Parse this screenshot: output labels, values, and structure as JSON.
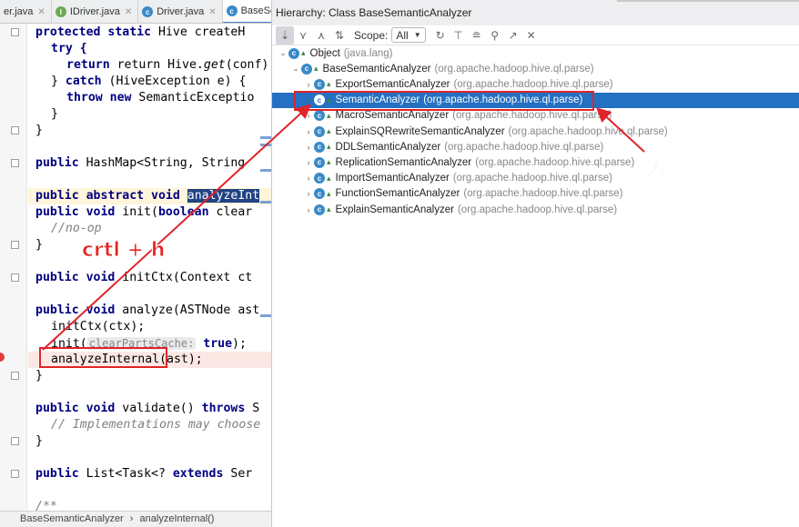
{
  "tabs": [
    {
      "label": "er.java",
      "icon": "",
      "color": "#e0a030"
    },
    {
      "label": "IDriver.java",
      "icon": "I",
      "color": "#6aab50"
    },
    {
      "label": "Driver.java",
      "icon": "c",
      "color": "#3a8ac8"
    },
    {
      "label": "BaseSema",
      "icon": "c",
      "color": "#3a8ac8"
    }
  ],
  "code": {
    "l1": [
      "protected",
      "static",
      "Hive createH"
    ],
    "l2": "try {",
    "l3a": "return Hive.",
    "l3b": "get",
    "l3c": "(conf);",
    "l4a": "} ",
    "l4b": "catch",
    "l4c": " (HiveException e) {",
    "l5a": "throw new",
    "l5b": " SemanticExceptio",
    "l6": "}",
    "l7": "}",
    "l8a": "public",
    "l8b": " HashMap<String, String",
    "l9a": "public abstract void",
    "l9b": "analyzeInt",
    "l10a": "public void",
    "l10b": " init(",
    "l10c": "boolean",
    "l10d": " clear",
    "l11": "//no-op",
    "l12": "}",
    "l13a": "public void",
    "l13b": " initCtx(Context ct",
    "l14a": "public void",
    "l14b": " analyze(ASTNode ast",
    "l15": "initCtx(ctx);",
    "l16a": "init(",
    "l16b": "clearPartsCache:",
    "l16c": "true",
    "l16d": ");",
    "l17": "analyzeInternal(ast);",
    "l18": "}",
    "l19a": "public void",
    "l19b": " validate() ",
    "l19c": "throws",
    "l19d": " S",
    "l20": "// Implementations may choose",
    "l21": "}",
    "l22a": "public",
    "l22b": " List<Task<? ",
    "l22c": "extends",
    "l22d": " Ser",
    "l23": "/**"
  },
  "status": {
    "crumb1": "BaseSemanticAnalyzer",
    "sep": "›",
    "crumb2": "analyzeInternal()"
  },
  "panel": {
    "title": "Hierarchy:  Class BaseSemanticAnalyzer",
    "scope_label": "Scope:",
    "scope_value": "All",
    "icons": [
      "type-hierarchy-icon",
      "supertypes-icon",
      "subtypes-icon",
      "sort-alpha-icon",
      "scope-dropdown",
      "refresh-icon",
      "export-icon",
      "autoscroll-icon",
      "pin-icon",
      "open-in-editor-icon",
      "close-icon"
    ]
  },
  "tree": [
    {
      "name": "Object",
      "pkg": "(java.lang)",
      "level": 0,
      "arrow": "v"
    },
    {
      "name": "BaseSemanticAnalyzer",
      "pkg": "(org.apache.hadoop.hive.ql.parse)",
      "level": 1,
      "arrow": "v"
    },
    {
      "name": "ExportSemanticAnalyzer",
      "pkg": "(org.apache.hadoop.hive.ql.parse)",
      "level": 2,
      "arrow": ">"
    },
    {
      "name": "SemanticAnalyzer",
      "pkg": "(org.apache.hadoop.hive.ql.parse)",
      "level": 2,
      "arrow": ">",
      "selected": true
    },
    {
      "name": "MacroSemanticAnalyzer",
      "pkg": "(org.apache.hadoop.hive.ql.parse)",
      "level": 2,
      "arrow": ">"
    },
    {
      "name": "ExplainSQRewriteSemanticAnalyzer",
      "pkg": "(org.apache.hadoop.hive.ql.parse)",
      "level": 2,
      "arrow": ">"
    },
    {
      "name": "DDLSemanticAnalyzer",
      "pkg": "(org.apache.hadoop.hive.ql.parse)",
      "level": 2,
      "arrow": ">"
    },
    {
      "name": "ReplicationSemanticAnalyzer",
      "pkg": "(org.apache.hadoop.hive.ql.parse)",
      "level": 2,
      "arrow": ">"
    },
    {
      "name": "ImportSemanticAnalyzer",
      "pkg": "(org.apache.hadoop.hive.ql.parse)",
      "level": 2,
      "arrow": ">"
    },
    {
      "name": "FunctionSemanticAnalyzer",
      "pkg": "(org.apache.hadoop.hive.ql.parse)",
      "level": 2,
      "arrow": ">"
    },
    {
      "name": "ExplainSemanticAnalyzer",
      "pkg": "(org.apache.hadoop.hive.ql.parse)",
      "level": 2,
      "arrow": ">"
    }
  ],
  "annotations": {
    "ctrl_h": "crtl + h",
    "query": "关于查询"
  },
  "colors": {
    "accent": "#2470c2",
    "annotation": "#e0242a"
  }
}
